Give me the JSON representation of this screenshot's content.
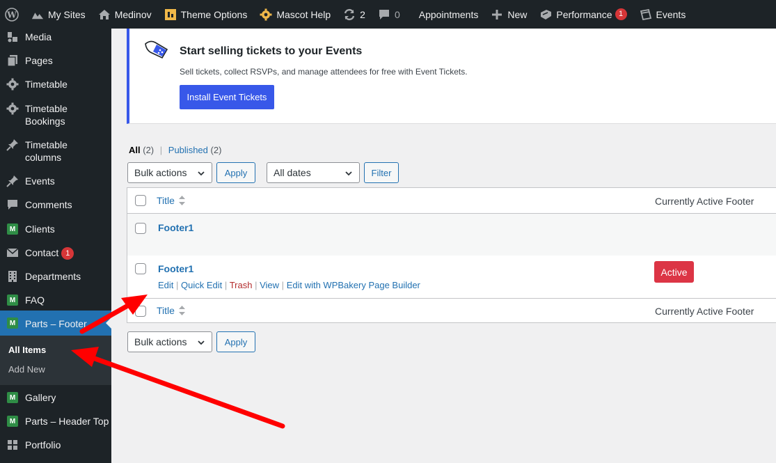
{
  "adminbar": {
    "my_sites": "My Sites",
    "site_name": "Medinov",
    "theme_options": "Theme Options",
    "mascot_help": "Mascot Help",
    "updates_count": "2",
    "comments_count": "0",
    "appointments": "Appointments",
    "new": "New",
    "performance": "Performance",
    "performance_badge": "1",
    "events": "Events"
  },
  "sidebar": {
    "items": [
      {
        "label": "Media",
        "icon": "media-icon"
      },
      {
        "label": "Pages",
        "icon": "pages-icon"
      },
      {
        "label": "Timetable",
        "icon": "gear-icon"
      },
      {
        "label": "Timetable Bookings",
        "icon": "gear-icon"
      },
      {
        "label": "Timetable columns",
        "icon": "pin-icon"
      },
      {
        "label": "Events",
        "icon": "pin-icon"
      },
      {
        "label": "Comments",
        "icon": "comment-icon"
      },
      {
        "label": "Clients",
        "icon": "m-icon"
      },
      {
        "label": "Contact",
        "icon": "mail-icon",
        "badge": "1"
      },
      {
        "label": "Departments",
        "icon": "building-icon"
      },
      {
        "label": "FAQ",
        "icon": "m-icon"
      },
      {
        "label": "Parts – Footer",
        "icon": "m-icon"
      },
      {
        "label": "Gallery",
        "icon": "m-icon"
      },
      {
        "label": "Parts – Header Top",
        "icon": "m-icon"
      },
      {
        "label": "Portfolio",
        "icon": "grid-icon"
      }
    ],
    "submenu": {
      "all_items": "All Items",
      "add_new": "Add New"
    },
    "m_letter": "M"
  },
  "notice": {
    "title": "Start selling tickets to your Events",
    "description": "Sell tickets, collect RSVPs, and manage attendees for free with Event Tickets.",
    "button": "Install Event Tickets"
  },
  "filters": {
    "all_label": "All",
    "all_count": "(2)",
    "separator": "|",
    "published_label": "Published",
    "published_count": "(2)",
    "bulk_actions": "Bulk actions",
    "apply": "Apply",
    "all_dates": "All dates",
    "filter": "Filter"
  },
  "table": {
    "col_title": "Title",
    "col_footer": "Currently Active Footer",
    "rows": [
      {
        "title": "Footer1"
      },
      {
        "title": "Footer1",
        "badge": "Active"
      }
    ],
    "row_actions": {
      "edit": "Edit",
      "quick_edit": "Quick Edit",
      "trash": "Trash",
      "view": "View",
      "edit_wpbakery": "Edit with WPBakery Page Builder",
      "sep": "|"
    }
  },
  "colors": {
    "accent": "#2271b1",
    "admin_dark": "#1d2327",
    "notice_accent": "#3858e9",
    "active_badge": "#dc3545",
    "annotation_arrow": "#ff0000"
  }
}
